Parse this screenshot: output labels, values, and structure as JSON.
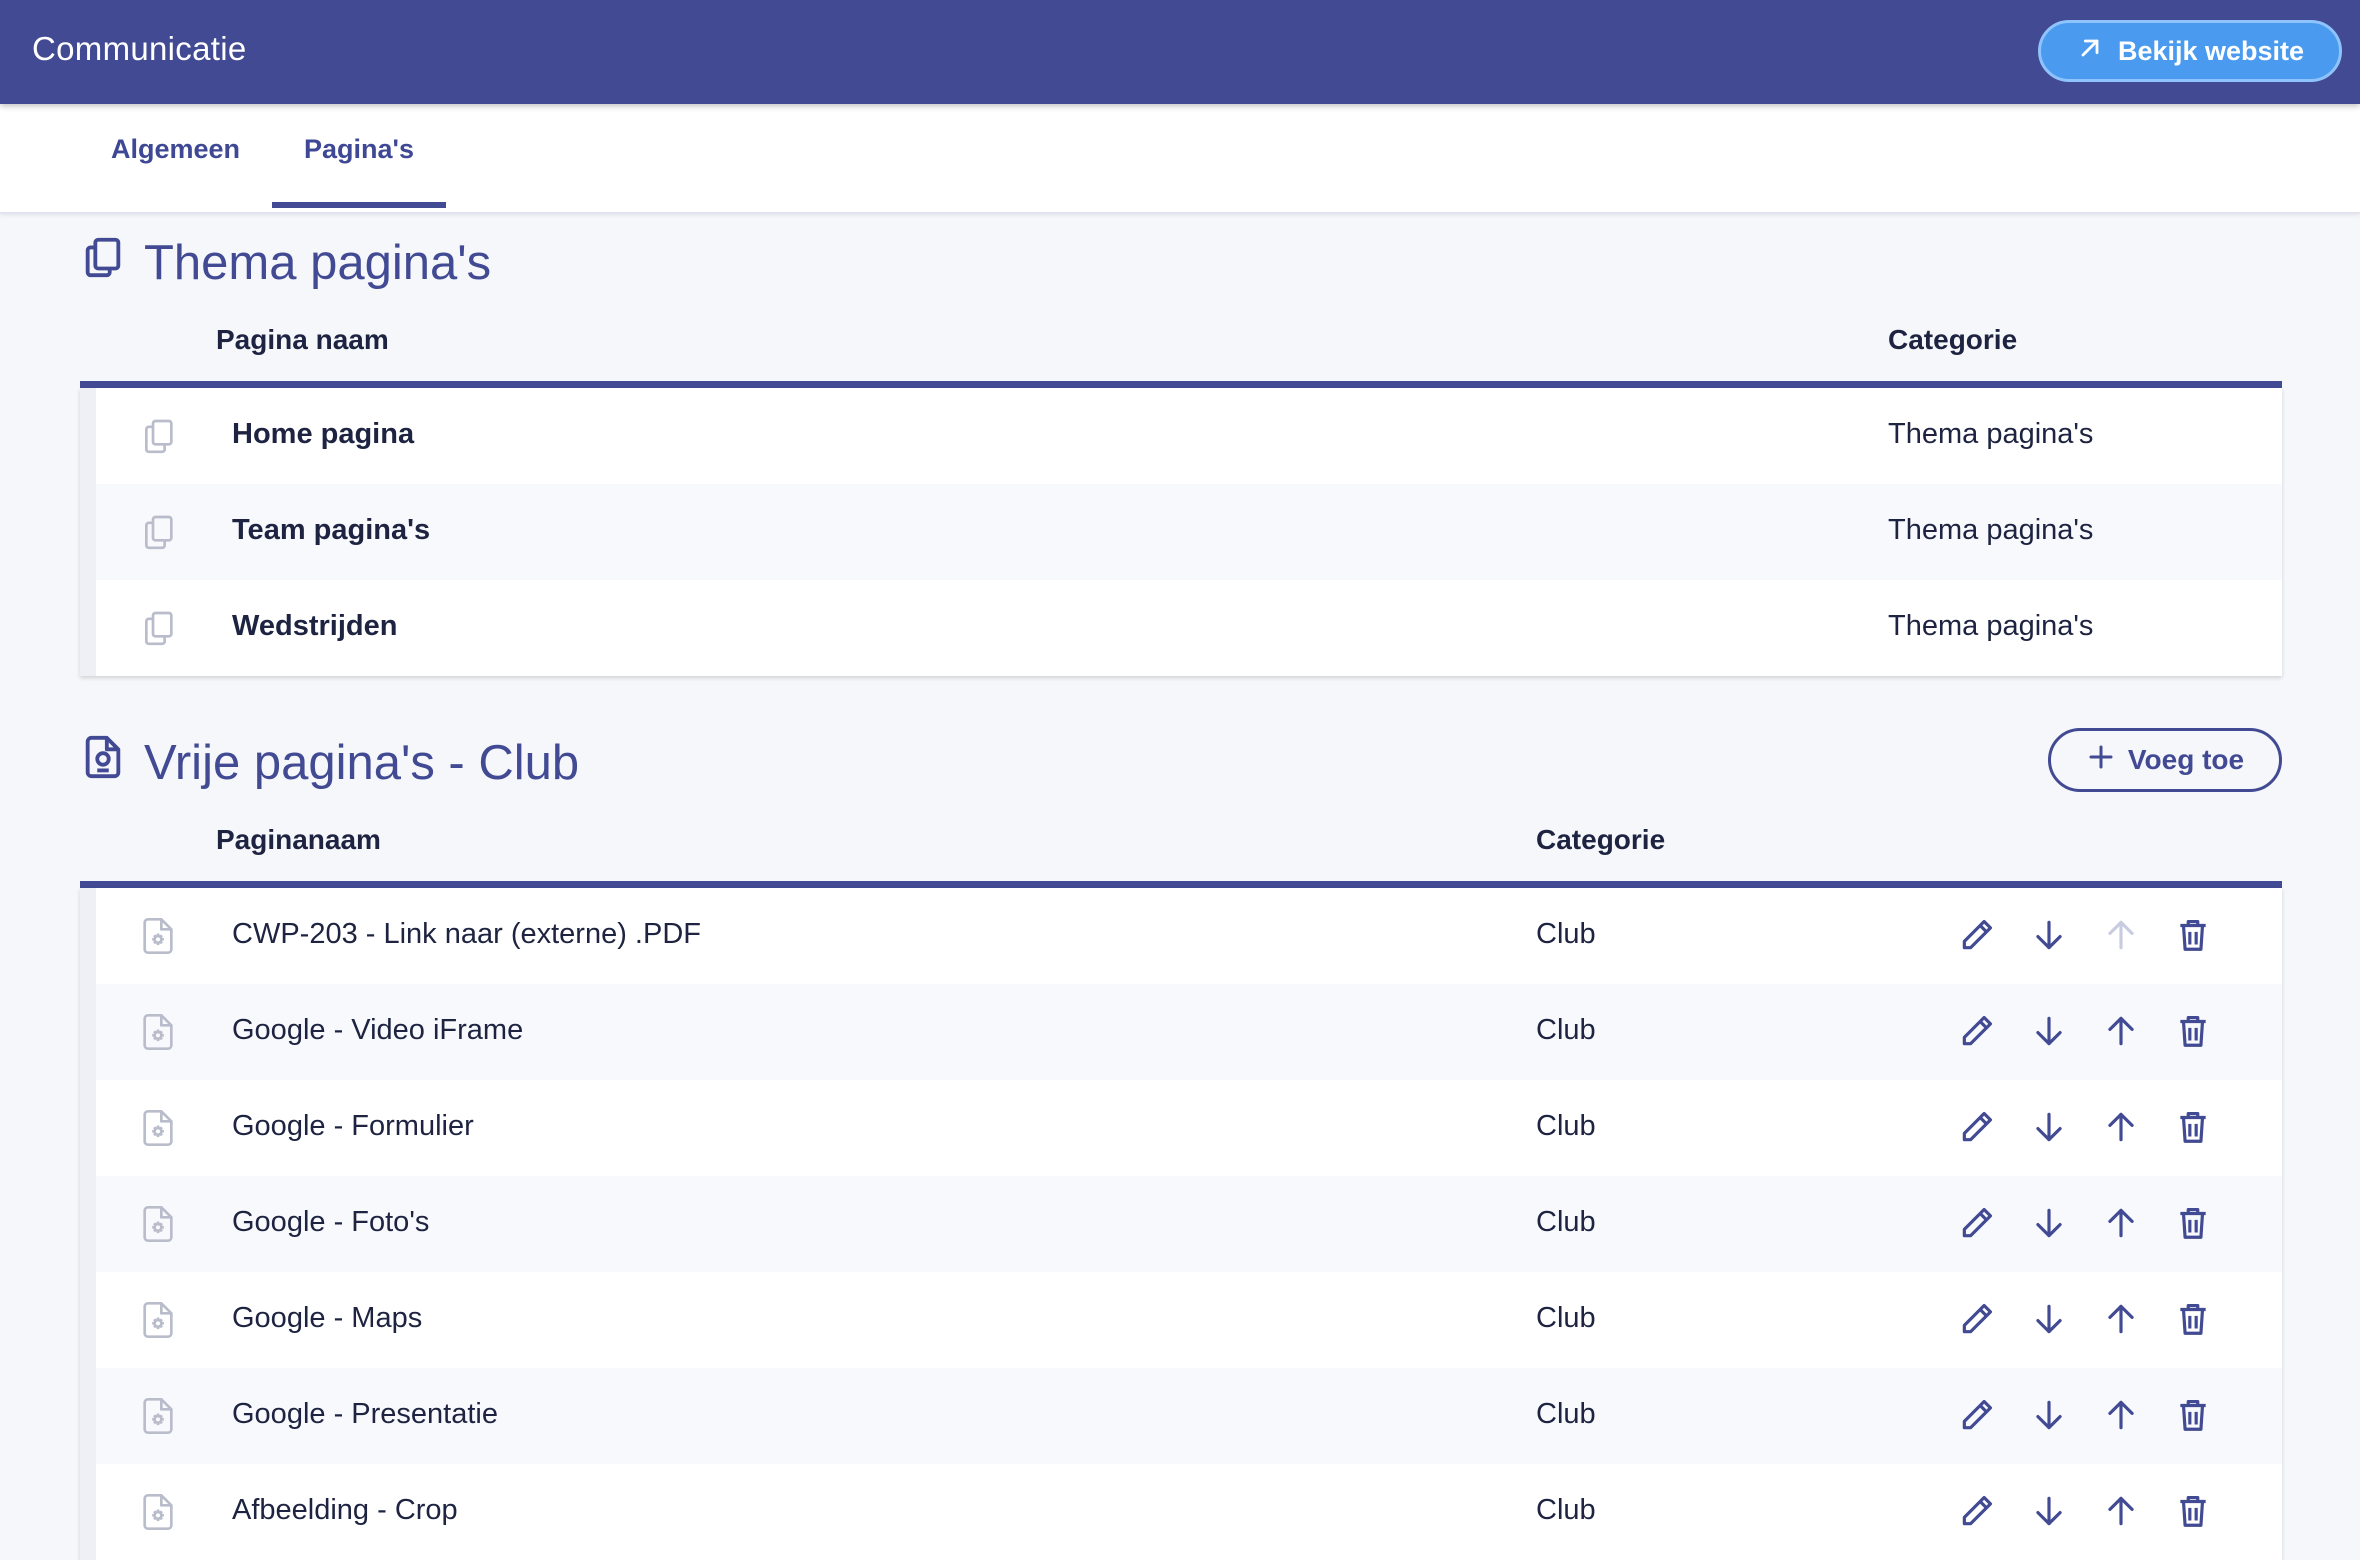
{
  "header": {
    "title": "Communicatie",
    "view_website_label": "Bekijk website"
  },
  "tabs": [
    {
      "label": "Algemeen",
      "active": false
    },
    {
      "label": "Pagina's",
      "active": true
    }
  ],
  "theme_section": {
    "title": "Thema pagina's",
    "columns": {
      "name": "Pagina naam",
      "category": "Categorie"
    },
    "rows": [
      {
        "name": "Home pagina",
        "category": "Thema pagina's"
      },
      {
        "name": "Team pagina's",
        "category": "Thema pagina's"
      },
      {
        "name": "Wedstrijden",
        "category": "Thema pagina's"
      }
    ]
  },
  "free_section": {
    "title": "Vrije pagina's - Club",
    "add_label": "Voeg toe",
    "columns": {
      "name": "Paginanaam",
      "category": "Categorie"
    },
    "rows": [
      {
        "name": "CWP-203 - Link naar (externe) .PDF",
        "category": "Club",
        "up_disabled": true
      },
      {
        "name": "Google - Video iFrame",
        "category": "Club",
        "up_disabled": false
      },
      {
        "name": "Google - Formulier",
        "category": "Club",
        "up_disabled": false
      },
      {
        "name": "Google - Foto's",
        "category": "Club",
        "up_disabled": false
      },
      {
        "name": "Google - Maps",
        "category": "Club",
        "up_disabled": false
      },
      {
        "name": "Google - Presentatie",
        "category": "Club",
        "up_disabled": false
      },
      {
        "name": "Afbeelding - Crop",
        "category": "Club",
        "up_disabled": false
      }
    ]
  },
  "colors": {
    "primary": "#414a93",
    "accent": "#4a9bf0",
    "background": "#f6f7fb"
  },
  "icons": {
    "view_website": "arrow-up-right-icon",
    "theme_section": "copy-pages-icon",
    "free_section": "page-badge-icon",
    "theme_row": "copy-pages-icon",
    "free_row": "page-gear-icon",
    "edit": "pencil-icon",
    "down": "arrow-down-icon",
    "up": "arrow-up-icon",
    "delete": "trash-icon",
    "add": "plus-icon"
  }
}
